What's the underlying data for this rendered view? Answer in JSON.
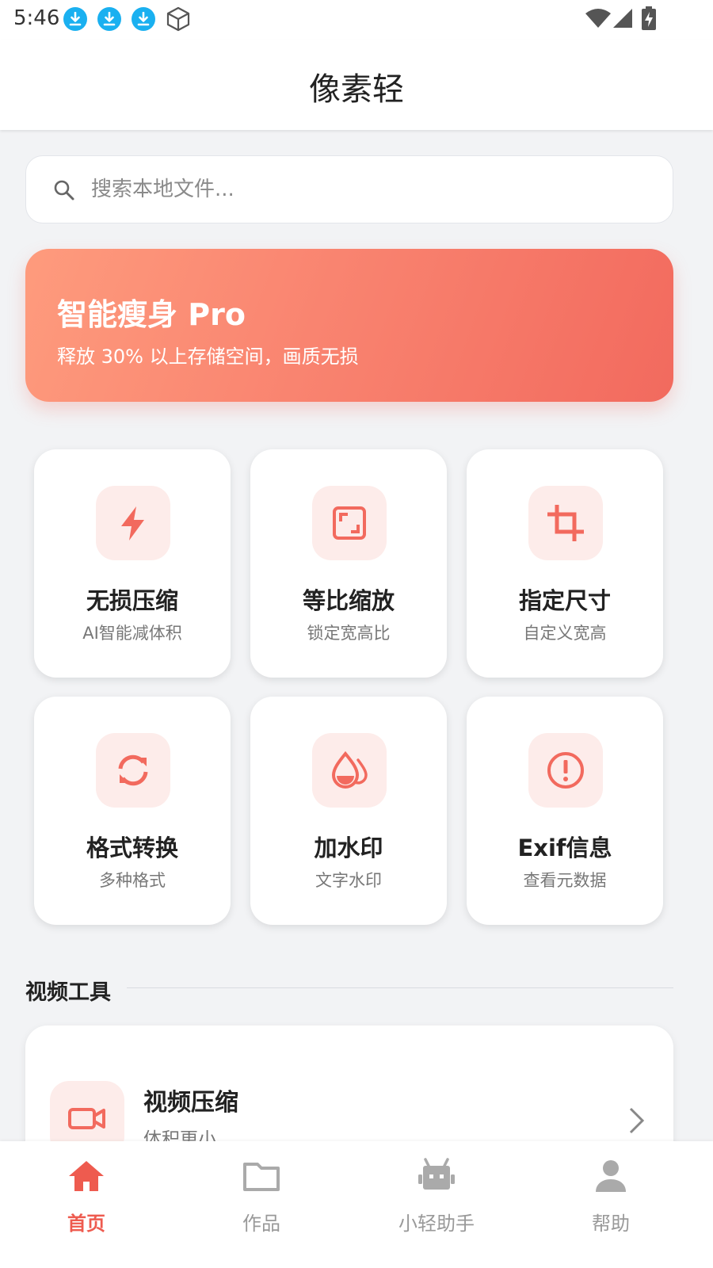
{
  "status_bar": {
    "time": "5:46",
    "icons": [
      "download-icon",
      "download-icon",
      "download-icon",
      "cube-icon",
      "wifi-icon",
      "cell-signal-icon",
      "battery-charging-icon"
    ]
  },
  "app_bar": {
    "title": "像素轻"
  },
  "search": {
    "placeholder": "搜索本地文件...",
    "value": "",
    "icon": "search-icon"
  },
  "banner": {
    "title": "智能瘦身 Pro",
    "subtitle": "释放 30% 以上存储空间，画质无损"
  },
  "tools": [
    {
      "title": "无损压缩",
      "subtitle": "AI智能减体积",
      "icon": "lightning-icon"
    },
    {
      "title": "等比缩放",
      "subtitle": "锁定宽高比",
      "icon": "aspect-ratio-icon"
    },
    {
      "title": "指定尺寸",
      "subtitle": "自定义宽高",
      "icon": "crop-icon"
    },
    {
      "title": "格式转换",
      "subtitle": "多种格式",
      "icon": "sync-icon"
    },
    {
      "title": "加水印",
      "subtitle": "文字水印",
      "icon": "water-drop-icon"
    },
    {
      "title": "Exif信息",
      "subtitle": "查看元数据",
      "icon": "info-alert-icon"
    }
  ],
  "video_section": {
    "title": "视频工具",
    "items": [
      {
        "title": "视频压缩",
        "subtitle": "体积更小",
        "icon": "video-camera-icon"
      }
    ]
  },
  "bottom_nav": {
    "accent": "#ee5b4f",
    "inactive_color": "#999999",
    "items": [
      {
        "label": "首页",
        "icon": "home-icon",
        "active": true
      },
      {
        "label": "作品",
        "icon": "folder-icon",
        "active": false
      },
      {
        "label": "小轻助手",
        "icon": "robot-icon",
        "active": false
      },
      {
        "label": "帮助",
        "icon": "person-icon",
        "active": false
      }
    ]
  },
  "colors": {
    "accent": "#f26a5e",
    "icon_bg": "#fdecea",
    "background": "#f2f3f5"
  }
}
